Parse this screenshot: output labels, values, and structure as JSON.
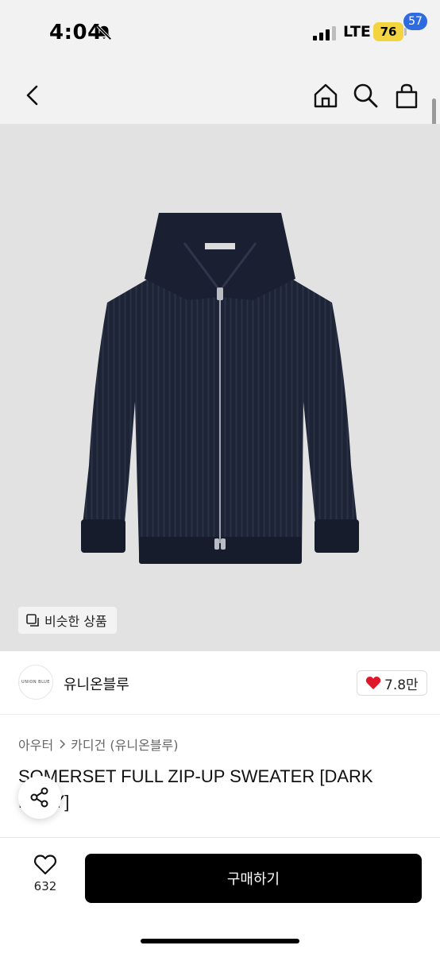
{
  "status_bar": {
    "time": "4:04",
    "network": "LTE",
    "battery": "76"
  },
  "nav": {
    "cart_count": "57"
  },
  "product_image": {
    "similar_button_label": "비슷한 상품"
  },
  "brand": {
    "logo_text": "UNION BLUE",
    "name": "유니온블루",
    "likes": "7.8만"
  },
  "breadcrumb": {
    "category": "아우터",
    "subcategory": "카디건 (유니온블루)"
  },
  "product": {
    "title": "SOMERSET FULL ZIP-UP SWEATER [DARK NAVY]"
  },
  "bottom_bar": {
    "wish_count": "632",
    "buy_label": "구매하기"
  },
  "colors": {
    "accent_blue": "#2f6be0",
    "battery_yellow": "#f3d33f",
    "like_red": "#e0162b",
    "buy_black": "#000000",
    "sweater_navy": "#1d2436"
  }
}
